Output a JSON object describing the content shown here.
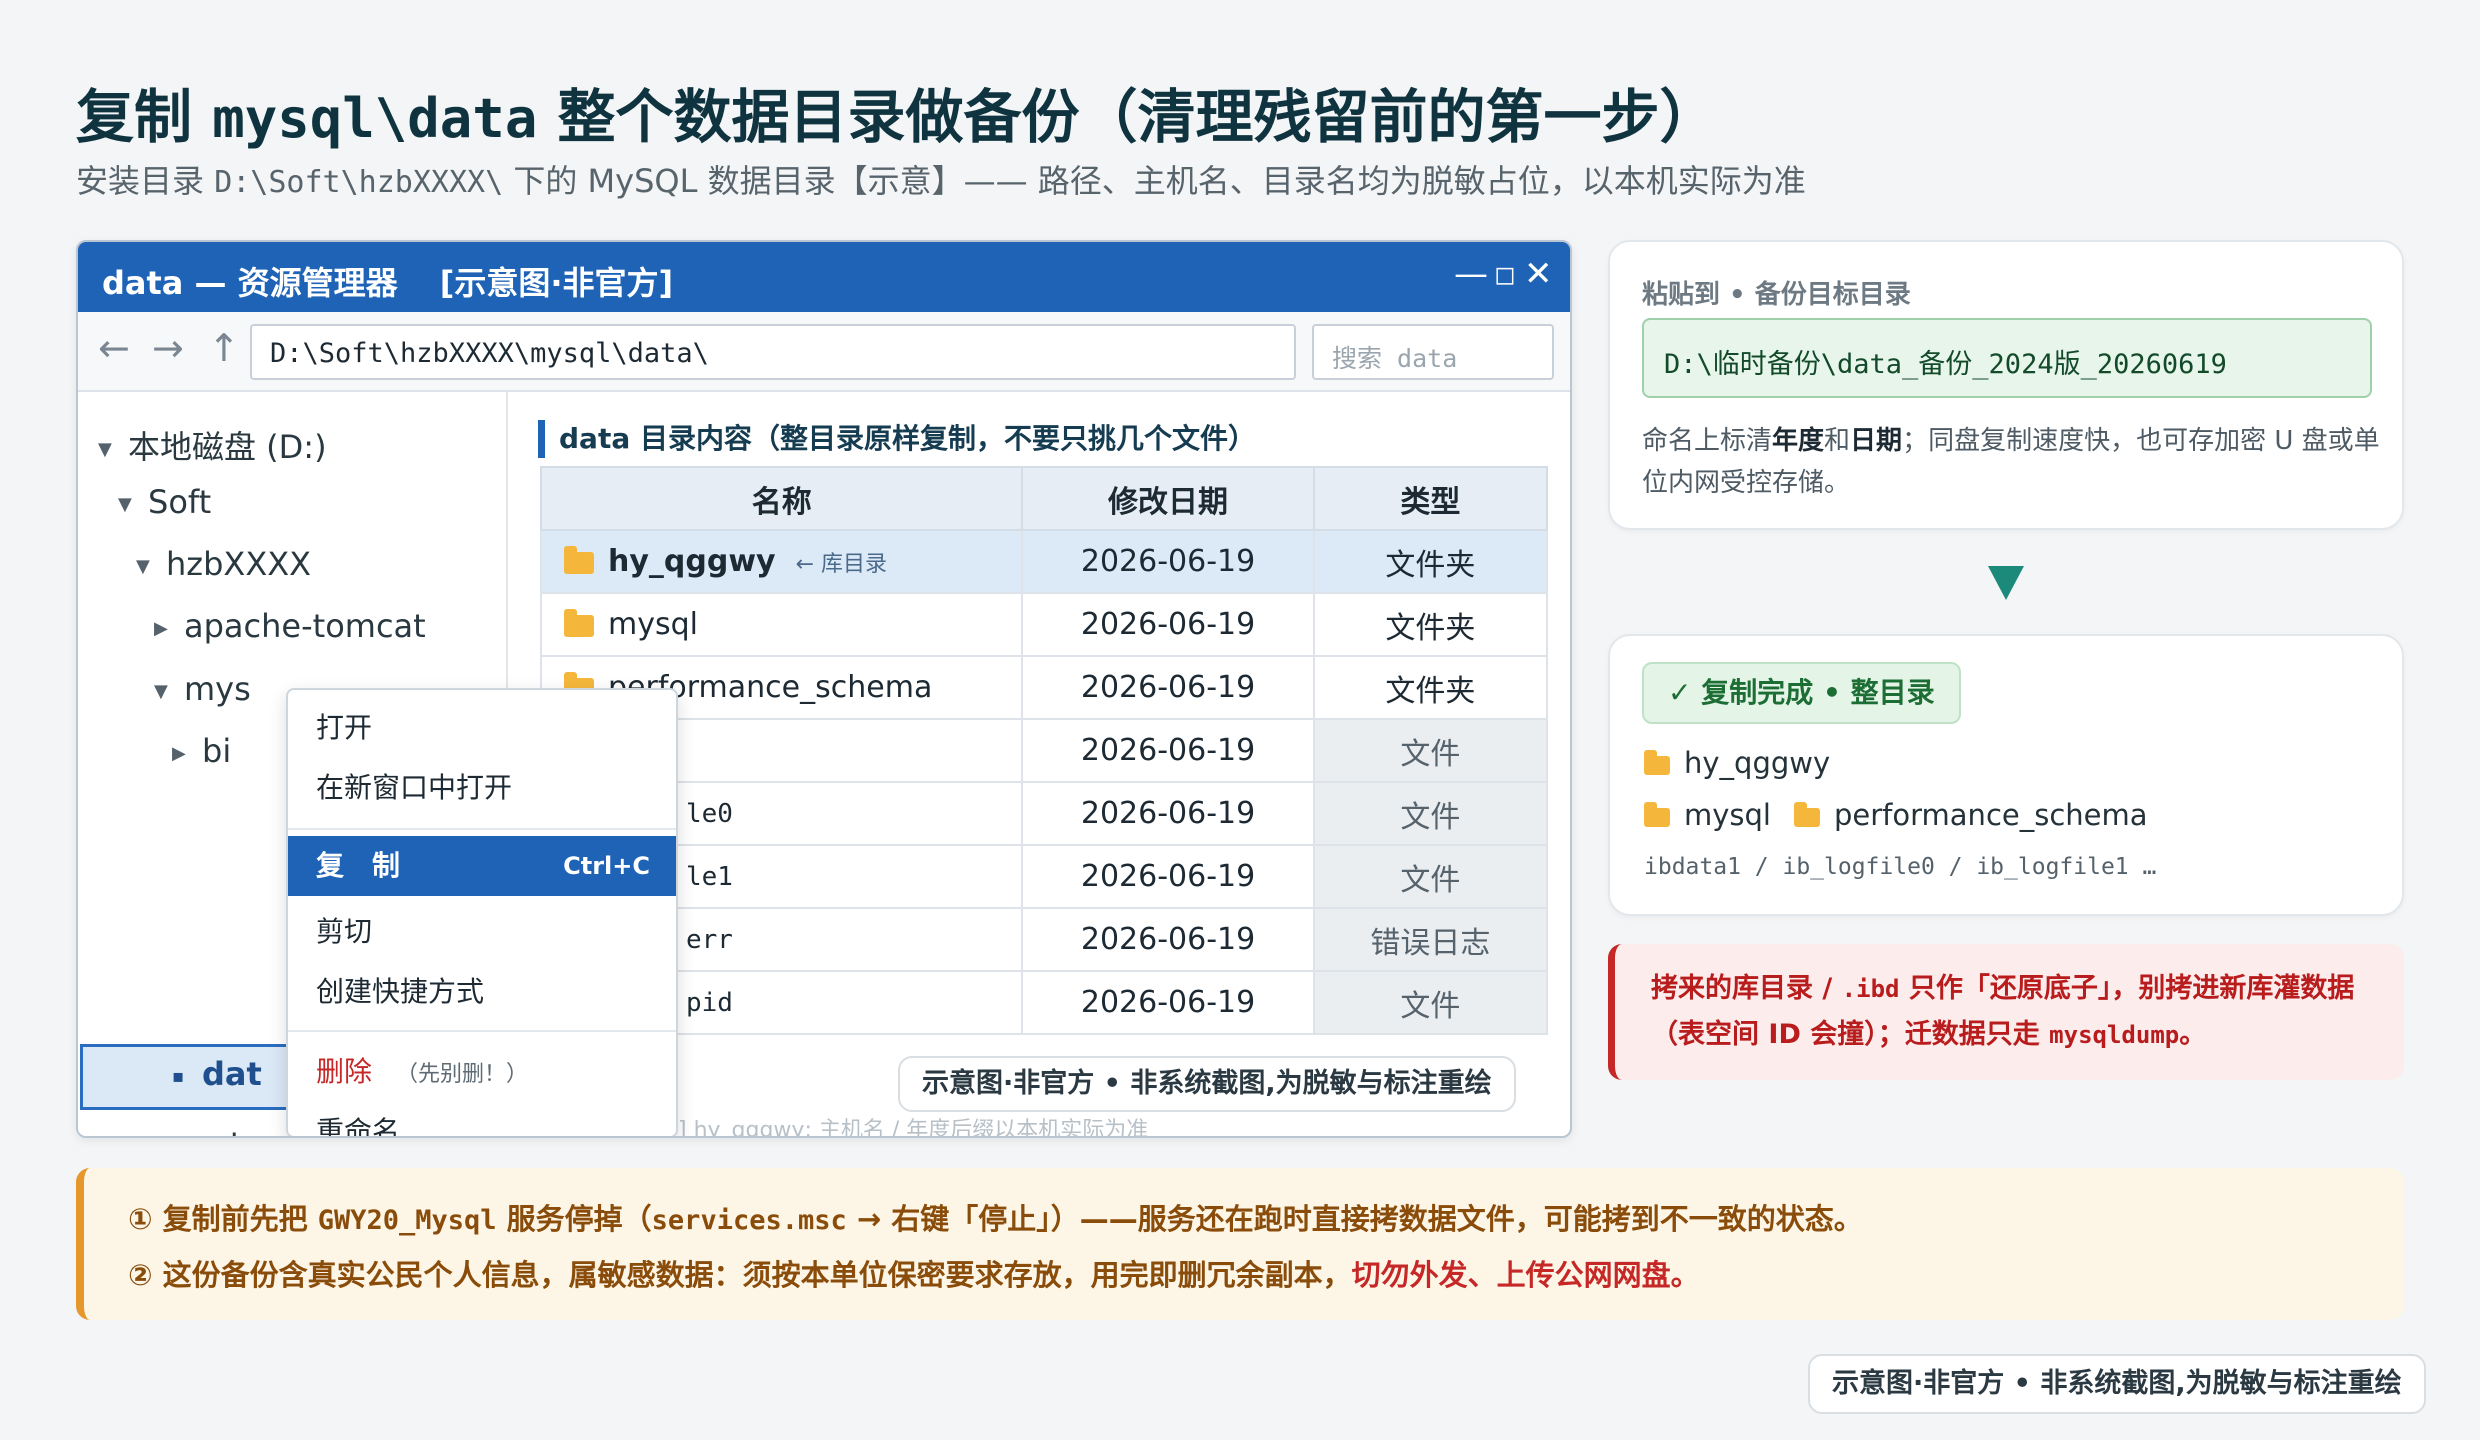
{
  "page": {
    "title_pre": "复制",
    "title_code": "mysql\\data",
    "title_post": "整个数据目录做备份（清理残留前的第一步）",
    "subtitle_pre": "安装目录",
    "subtitle_code": "D:\\Soft\\hzbXXXX\\",
    "subtitle_post": "下的 MySQL 数据目录【示意】—— 路径、主机名、目录名均为脱敏占位，以本机实际为准"
  },
  "window": {
    "title": "data — 资源管理器",
    "title_tag": "[示意图·非官方]",
    "minimize": "—",
    "maximize": "◻",
    "close": "✕",
    "back": "←",
    "forward": "→",
    "up": "↑",
    "address": "D:\\Soft\\hzbXXXX\\mysql\\data\\",
    "search_placeholder": "搜索 data"
  },
  "tree": {
    "items": [
      {
        "label": "本地磁盘 (D:)",
        "arrow": "▼"
      },
      {
        "label": "Soft",
        "arrow": "▼"
      },
      {
        "label": "hzbXXXX",
        "arrow": "▼"
      },
      {
        "label": "apache-tomcat",
        "arrow": "▶"
      },
      {
        "label": "mys",
        "arrow": "▼"
      },
      {
        "label": "bi",
        "arrow": "▶"
      },
      {
        "label": "dat",
        "arrow": "▪"
      },
      {
        "label": "web",
        "arrow": "▶"
      }
    ]
  },
  "content": {
    "heading": "data 目录内容（整目录原样复制，不要只挑几个文件）",
    "columns": [
      "名称",
      "修改日期",
      "类型"
    ],
    "rows": [
      {
        "name": "hy_qggwy",
        "note": "← 库目录",
        "date": "2026-06-19",
        "type": "文件夹"
      },
      {
        "name": "mysql",
        "date": "2026-06-19",
        "type": "文件夹"
      },
      {
        "name": "performance_schema",
        "date": "2026-06-19",
        "type": "文件夹"
      },
      {
        "name": "",
        "date": "2026-06-19",
        "type": "文件"
      },
      {
        "name": "le0",
        "date": "2026-06-19",
        "type": "文件"
      },
      {
        "name": "le1",
        "date": "2026-06-19",
        "type": "文件"
      },
      {
        "name": "err",
        "date": "2026-06-19",
        "type": "错误日志"
      },
      {
        "name": "pid",
        "date": "2026-06-19",
        "type": "文件"
      }
    ],
    "ghost_row": "2026-06-19",
    "ghost_footer": "] hy_qggwy; 主机名 / 年度后缀以本机实际为准"
  },
  "context_menu": {
    "open": "打开",
    "open_new": "在新窗口中打开",
    "copy": "复　制",
    "copy_shortcut": "Ctrl+C",
    "cut": "剪切",
    "shortcut": "创建快捷方式",
    "delete": "删除",
    "delete_hint": "（先别删！）",
    "rename": "重命名"
  },
  "watermark": "示意图·非官方 • 非系统截图,为脱敏与标注重绘",
  "paste_card": {
    "label": "粘贴到 • 备份目标目录",
    "path": "D:\\临时备份\\data_备份_2024版_20260619",
    "desc_a": "命名上标清",
    "desc_b": "年度",
    "desc_c": "和",
    "desc_d": "日期",
    "desc_e": "；同盘复制速度快，也可存加密 U 盘或单位内网受控存储。"
  },
  "done_card": {
    "badge": "✓ 复制完成 • 整目录",
    "folder1": "hy_qggwy",
    "folder2": "mysql",
    "folder3": "performance_schema",
    "files": "ibdata1 / ib_logfile0 / ib_logfile1 …"
  },
  "warn": {
    "a": "拷来的库目录 / ",
    "b": ".ibd",
    "c": " 只作「还原底子」，别拷进新库灌数据（表空间 ID 会撞）；迁数据只走 ",
    "d": "mysqldump",
    "e": "。"
  },
  "notice": {
    "l1_a": "① 复制前先把 ",
    "l1_b": "GWY20_Mysql",
    "l1_c": " 服务停掉（",
    "l1_d": "services.msc",
    "l1_e": " → 右键「停止」）——服务还在跑时直接拷数据文件，可能拷到不一致的状态。",
    "l2_a": "② 这份备份含真实公民个人信息，属敏感数据：须按本单位保密要求存放，用完即删冗余副本，",
    "l2_b": "切勿外发、上传公网网盘。"
  },
  "colors": {
    "accent": "#1f63b7",
    "success": "#1d6e34",
    "danger": "#c62828",
    "warning": "#e6972c",
    "folder": "#f5b73b"
  },
  "icons": [
    "folder-icon",
    "arrow-down-icon",
    "check-icon"
  ]
}
